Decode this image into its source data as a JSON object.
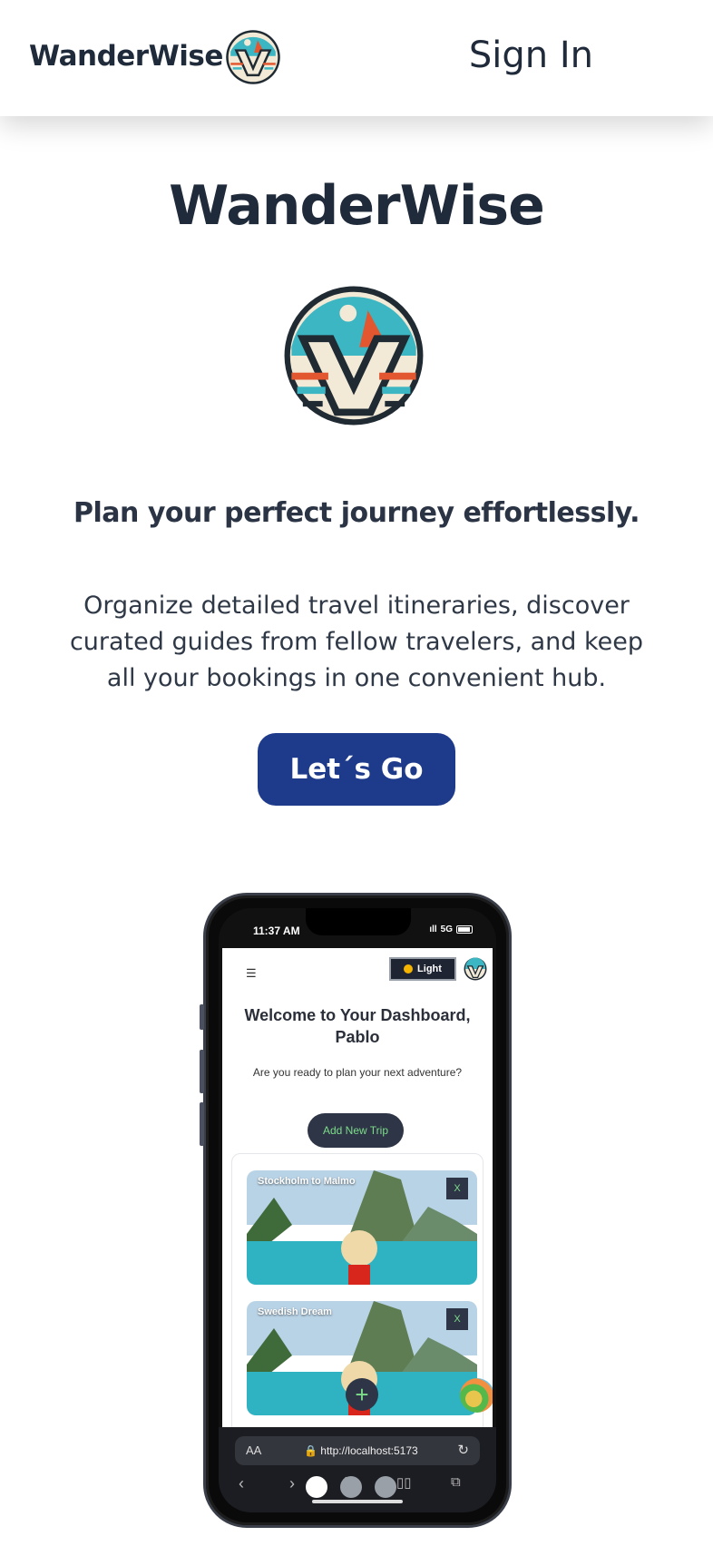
{
  "header": {
    "brand": "WanderWise",
    "signin_label": "Sign In"
  },
  "hero": {
    "title": "WanderWise",
    "tagline": "Plan your perfect journey effortlessly.",
    "description": "Organize detailed travel itineraries, discover curated guides from fellow travelers, and keep all your bookings in one convenient hub.",
    "cta_label": "Let´s Go"
  },
  "phone": {
    "status": {
      "time": "11:37 AM",
      "network": "5G"
    },
    "app": {
      "theme_toggle_label": "Light",
      "dashboard_title": "Welcome to Your Dashboard, Pablo",
      "dashboard_subtitle": "Are you ready to plan your next adventure?",
      "add_trip_label": "Add New Trip",
      "trips": [
        {
          "title": "Stockholm to Malmo",
          "close_label": "X"
        },
        {
          "title": "Swedish Dream",
          "close_label": "X"
        }
      ],
      "fab_label": "+"
    },
    "browser": {
      "text_size_label": "AA",
      "url": "http://localhost:5173"
    }
  },
  "colors": {
    "primary": "#1e3a8a",
    "text_dark": "#1f2a3a",
    "accent_green": "#7ddc8a",
    "app_dark": "#2d3546"
  },
  "icons": [
    "brand-logo-icon",
    "hamburger-icon",
    "sun-icon",
    "lock-icon",
    "reload-icon",
    "back-icon",
    "forward-icon",
    "share-icon",
    "bookmarks-icon",
    "tabs-icon"
  ]
}
